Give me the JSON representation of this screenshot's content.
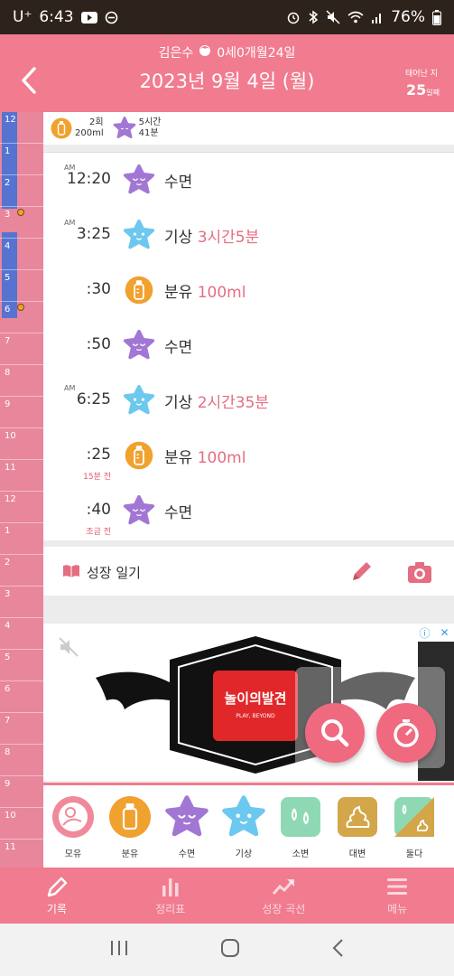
{
  "status_bar": {
    "carrier": "U⁺",
    "time": "6:43",
    "battery": "76%"
  },
  "header": {
    "baby_name": "김은수",
    "age": "0세0개월24일",
    "date": "2023년 9월 4일 (월)",
    "born_label": "태어난 지",
    "born_days": "25",
    "born_unit": "일째"
  },
  "timeline": {
    "hours": [
      "12",
      "1",
      "2",
      "3",
      "4",
      "5",
      "6",
      "7",
      "8",
      "9",
      "10",
      "11",
      "12",
      "1",
      "2",
      "3",
      "4",
      "5",
      "6",
      "7",
      "8",
      "9",
      "10",
      "11"
    ]
  },
  "summary": {
    "feeding_count": "2회",
    "feeding_amount": "200ml",
    "sleep_hours": "5시간",
    "sleep_minutes": "41분"
  },
  "records": [
    {
      "ampm": "AM",
      "time": "12:20",
      "type": "sleep",
      "label": "수면",
      "detail": "",
      "note": ""
    },
    {
      "ampm": "AM",
      "time": "3:25",
      "type": "wake",
      "label": "기상",
      "detail": "3시간5분",
      "note": ""
    },
    {
      "ampm": "",
      "time": ":30",
      "type": "formula",
      "label": "분유",
      "detail": "100ml",
      "note": ""
    },
    {
      "ampm": "",
      "time": ":50",
      "type": "sleep",
      "label": "수면",
      "detail": "",
      "note": ""
    },
    {
      "ampm": "AM",
      "time": "6:25",
      "type": "wake",
      "label": "기상",
      "detail": "2시간35분",
      "note": ""
    },
    {
      "ampm": "",
      "time": ":25",
      "type": "formula",
      "label": "분유",
      "detail": "100ml",
      "note": "15분 전"
    },
    {
      "ampm": "",
      "time": ":40",
      "type": "sleep",
      "label": "수면",
      "detail": "",
      "note": "조금 전"
    }
  ],
  "diary": {
    "title": "성장 일기"
  },
  "ad": {
    "brand_main": "놀이의발견",
    "brand_sub": "PLAY, BEYOND"
  },
  "quick_add": [
    {
      "label": "모유",
      "icon": "breastfeed-icon"
    },
    {
      "label": "분유",
      "icon": "bottle-icon"
    },
    {
      "label": "수면",
      "icon": "sleep-icon"
    },
    {
      "label": "기상",
      "icon": "wake-icon"
    },
    {
      "label": "소변",
      "icon": "pee-icon"
    },
    {
      "label": "대변",
      "icon": "poop-icon"
    },
    {
      "label": "둘다",
      "icon": "both-icon"
    }
  ],
  "nav": [
    {
      "label": "기록",
      "active": true
    },
    {
      "label": "정리표",
      "active": false
    },
    {
      "label": "성장 곡선",
      "active": false
    },
    {
      "label": "메뉴",
      "active": false
    }
  ],
  "colors": {
    "brand_pink": "#f17b8f",
    "sleep_purple": "#a277d4",
    "wake_blue": "#6cc8ee",
    "formula_orange": "#f0a12e",
    "detail_pink": "#e56d82"
  }
}
